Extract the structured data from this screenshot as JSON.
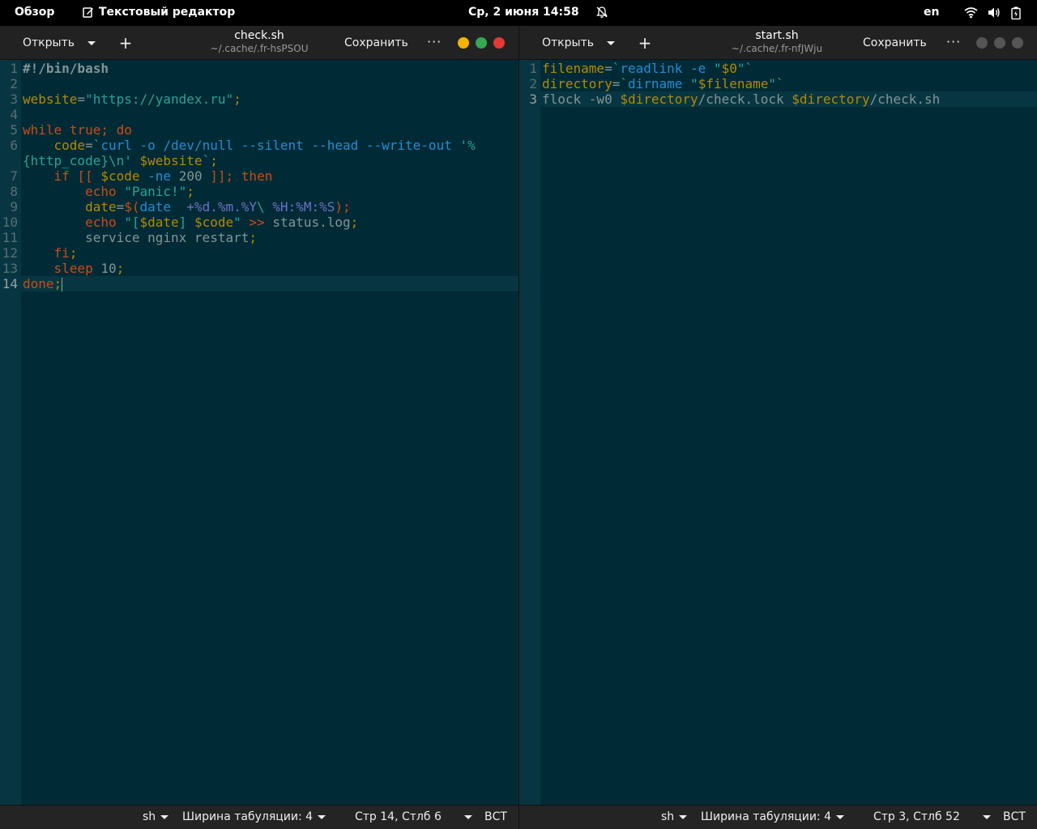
{
  "topbar": {
    "overview": "Обзор",
    "app_name": "Текстовый редактор",
    "datetime": "Ср, 2 июня  14:58",
    "lang": "en",
    "icons": [
      "wifi-icon",
      "volume-icon",
      "battery-icon"
    ]
  },
  "left": {
    "open_label": "Открыть",
    "title": "check.sh",
    "subtitle": "~/.cache/.fr-hsPSOU",
    "save_label": "Сохранить",
    "menu_label": "···",
    "window_controls": [
      "#f4b400",
      "#34a853",
      "#e53935"
    ],
    "status": {
      "lang": "sh",
      "tab_width": "Ширина табуляции: 4",
      "position": "Стр 14, Стлб 6",
      "mode": "ВСТ"
    },
    "line_numbers": [
      "1",
      "2",
      "3",
      "4",
      "5",
      "6",
      "",
      "7",
      "8",
      "9",
      "10",
      "11",
      "12",
      "13",
      "14"
    ]
  },
  "right": {
    "open_label": "Открыть",
    "title": "start.sh",
    "subtitle": "~/.cache/.fr-nfJWju",
    "save_label": "Сохранить",
    "menu_label": "···",
    "window_controls": [
      "#555555",
      "#555555",
      "#555555"
    ],
    "status": {
      "lang": "sh",
      "tab_width": "Ширина табуляции: 4",
      "position": "Стр 3, Стлб 52",
      "mode": "ВСТ"
    },
    "line_numbers": [
      "1",
      "2",
      "3"
    ]
  }
}
